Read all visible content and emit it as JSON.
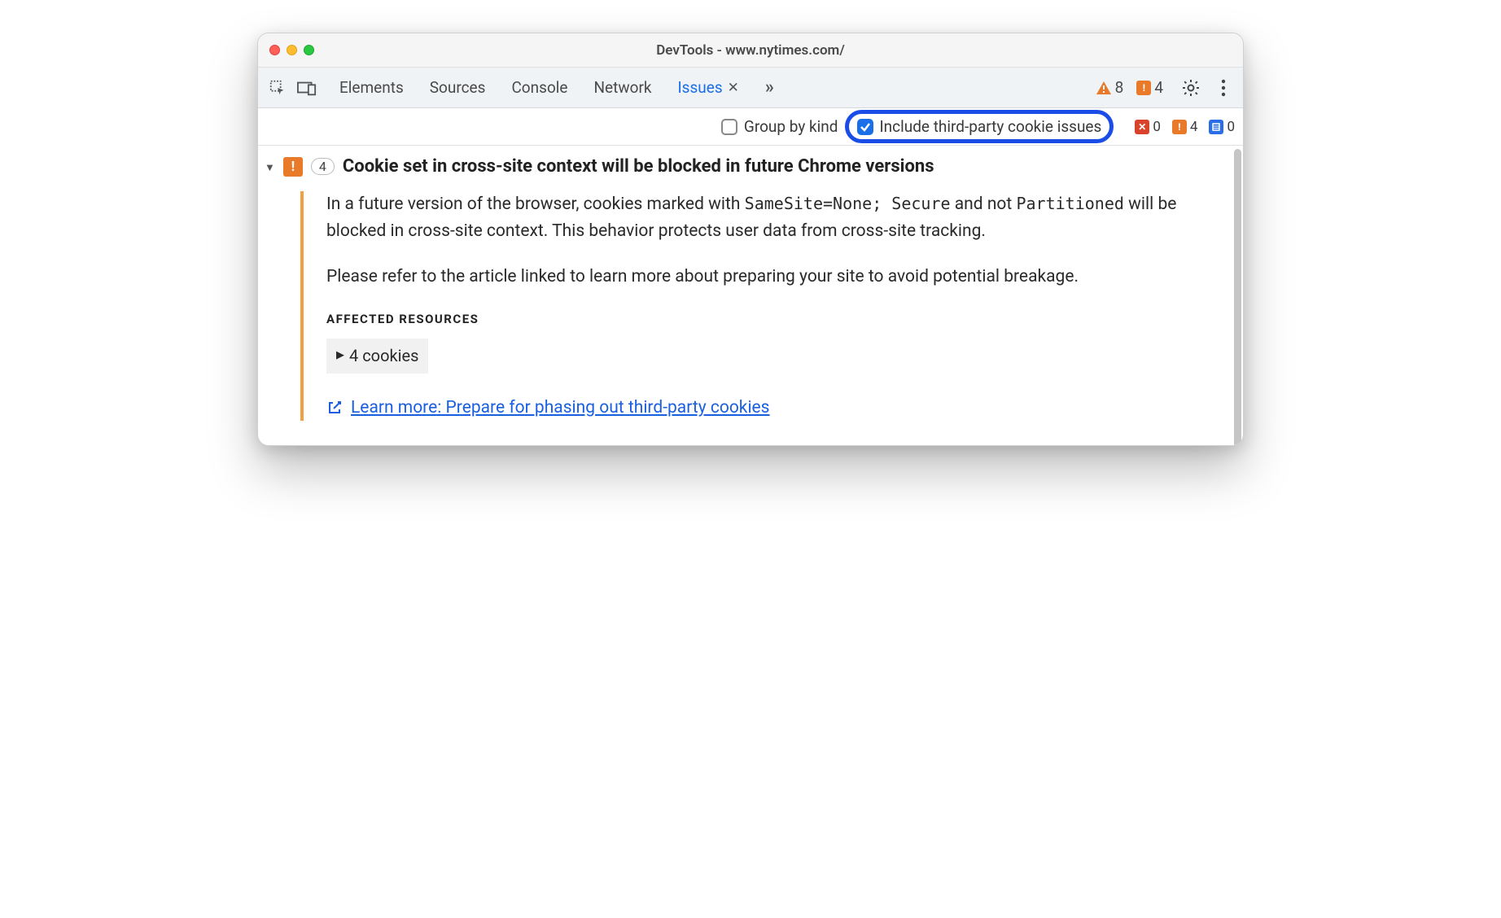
{
  "window": {
    "title": "DevTools - www.nytimes.com/"
  },
  "toolbar": {
    "tabs": {
      "elements": "Elements",
      "sources": "Sources",
      "console": "Console",
      "network": "Network",
      "issues": "Issues"
    },
    "warnings_count": "8",
    "errors_count": "4"
  },
  "filterbar": {
    "group_by_kind": "Group by kind",
    "include_third_party": "Include third-party cookie issues",
    "counts": {
      "red": "0",
      "orange": "4",
      "blue": "0"
    }
  },
  "issue": {
    "count": "4",
    "title": "Cookie set in cross-site context will be blocked in future Chrome versions",
    "para1_a": "In a future version of the browser, cookies marked with ",
    "para1_code1": "SameSite=None; Secure",
    "para1_b": " and not ",
    "para1_code2": "Partitioned",
    "para1_c": " will be blocked in cross-site context. This behavior protects user data from cross-site tracking.",
    "para2": "Please refer to the article linked to learn more about preparing your site to avoid potential breakage.",
    "affected_heading": "AFFECTED RESOURCES",
    "cookies_label": "4 cookies",
    "learn_more": "Learn more: Prepare for phasing out third-party cookies"
  }
}
